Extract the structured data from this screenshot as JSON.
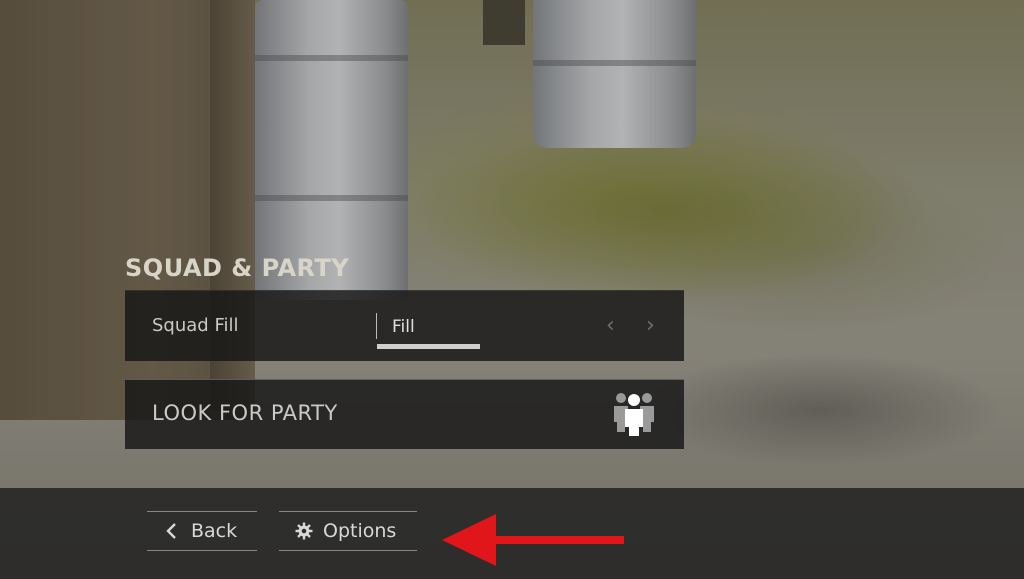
{
  "section": {
    "title": "SQUAD & PARTY"
  },
  "squad_fill": {
    "label": "Squad Fill",
    "value": "Fill"
  },
  "look_for_party": {
    "label": "LOOK FOR PARTY",
    "icon": "party-members-icon"
  },
  "footer": {
    "back_label": "Back",
    "options_label": "Options"
  },
  "annotation": {
    "color": "#e0161b",
    "icon": "red-pointer-arrow"
  }
}
